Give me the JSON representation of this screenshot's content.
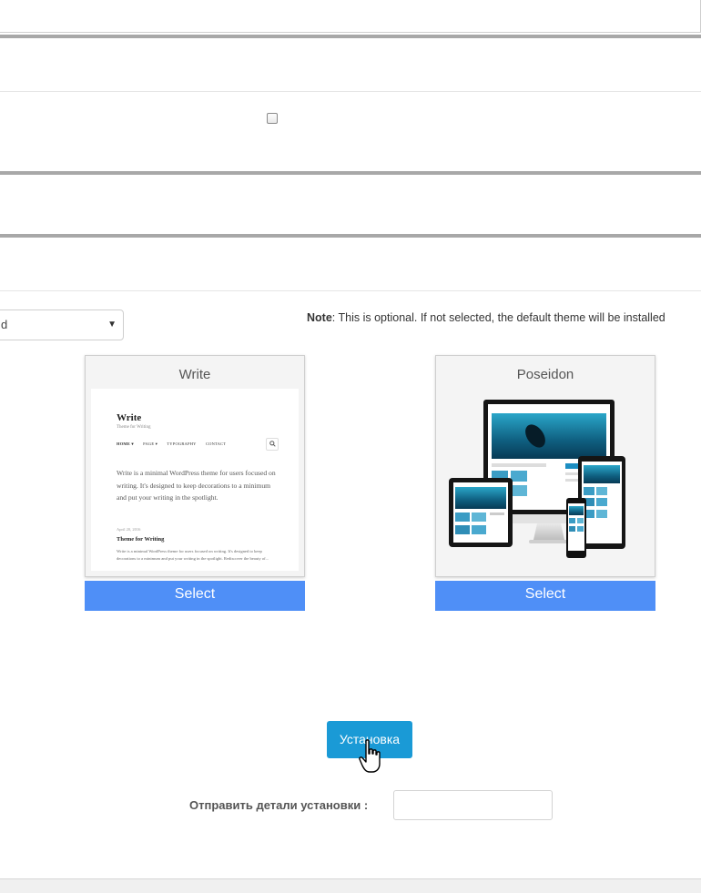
{
  "form": {
    "theme_select": {
      "value": "d"
    },
    "note": {
      "label": "Note",
      "text": ": This is optional. If not selected, the default theme will be installed"
    }
  },
  "themes": [
    {
      "name": "Write",
      "button_label": "Select",
      "preview": {
        "site_title": "Write",
        "tagline": "Theme for Writing",
        "nav": [
          "HOME ▾",
          "PAGE ▾",
          "TYPOGRAPHY",
          "CONTACT"
        ],
        "intro": "Write is a minimal WordPress theme for users focused on writing. It's designed to keep decorations to a minimum and put your writing in the spotlight.",
        "date": "April 20, 2016",
        "post_title": "Theme for Writing",
        "excerpt": "Write is a minimal WordPress theme for users focused on writing. It's designed to keep decorations to a minimum and put your writing in the spotlight. Rediscover the beauty of..."
      }
    },
    {
      "name": "Poseidon",
      "button_label": "Select"
    }
  ],
  "install": {
    "button_label": "Установка",
    "send_details_label": "Отправить детали установки :",
    "send_details_value": ""
  },
  "colors": {
    "select_button": "#4f8ff7",
    "install_button": "#1a9ad6"
  },
  "icons": {
    "dropdown": "chevron-down-icon",
    "cursor": "hand-pointer-icon",
    "search": "search-icon"
  }
}
